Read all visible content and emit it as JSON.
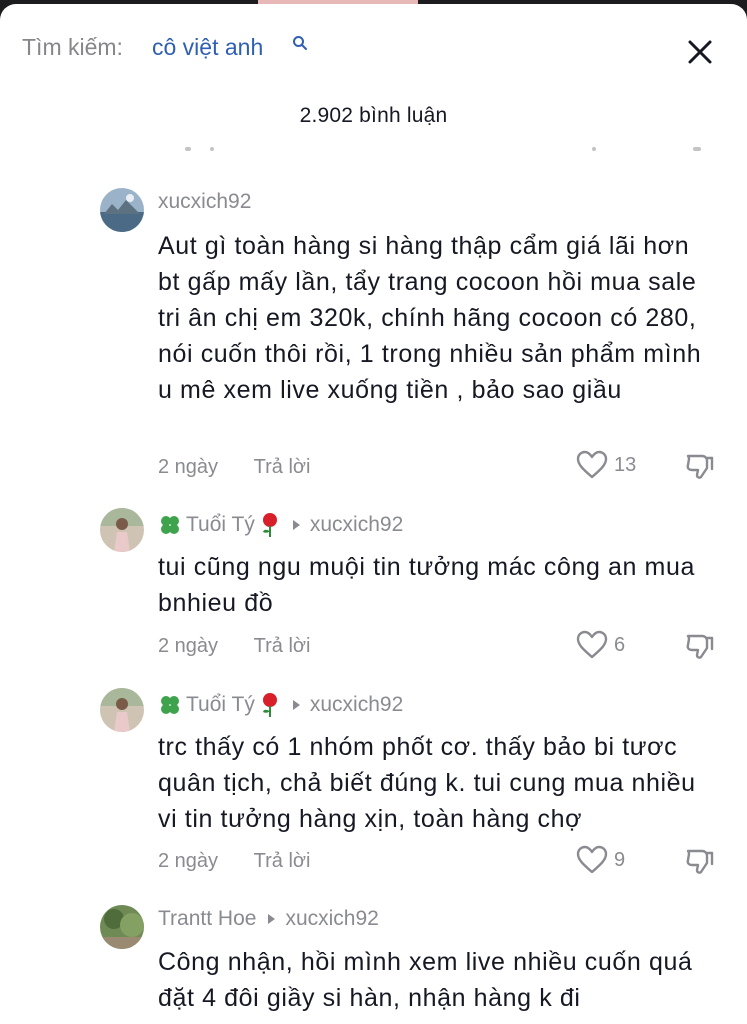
{
  "search": {
    "label": "Tìm kiếm:",
    "term": "cô việt anh"
  },
  "header": {
    "comment_count": "2.902 bình luận"
  },
  "comments": [
    {
      "username": "xucxich92",
      "reply_to": "",
      "text": "Aut gì toàn hàng si hàng thập cẩm giá lãi hơn bt gấp mấy lần, tẩy trang cocoon hồi mua sale tri ân chị em 320k, chính hãng cocoon có 280, nói cuốn thôi rồi, 1 trong nhiều sản phẩm mình u mê xem live xuống tiền , bảo sao giầu",
      "time": "2 ngày",
      "reply_label": "Trả lời",
      "likes": "13"
    },
    {
      "username": "Tuổi Tý",
      "reply_to": "xucxich92",
      "text": "tui cũng ngu muội tin tưởng mác công an mua bnhieu đồ",
      "time": "2 ngày",
      "reply_label": "Trả lời",
      "likes": "6"
    },
    {
      "username": "Tuổi Tý",
      "reply_to": "xucxich92",
      "text": "trc thấy có 1 nhóm phốt cơ. thấy bảo bi tươc quân tịch, chả biết đúng k. tui cung mua nhiều vi tin tưởng hàng xịn, toàn hàng chợ",
      "time": "2 ngày",
      "reply_label": "Trả lời",
      "likes": "9"
    },
    {
      "username": "Trantt Hoe",
      "reply_to": "xucxich92",
      "text": "Công nhận, hồi mình xem live nhiều cuốn quá đặt 4 đôi giầy si hàn, nhận hàng k đi",
      "time": "",
      "reply_label": "",
      "likes": ""
    }
  ],
  "icons": {
    "close": "close-icon",
    "search": "search-icon",
    "like": "heart-outline-icon",
    "dislike": "thumbs-down-icon"
  },
  "colors": {
    "search_term": "#2f5fb3",
    "muted": "#8a8b91",
    "text": "#161823"
  }
}
